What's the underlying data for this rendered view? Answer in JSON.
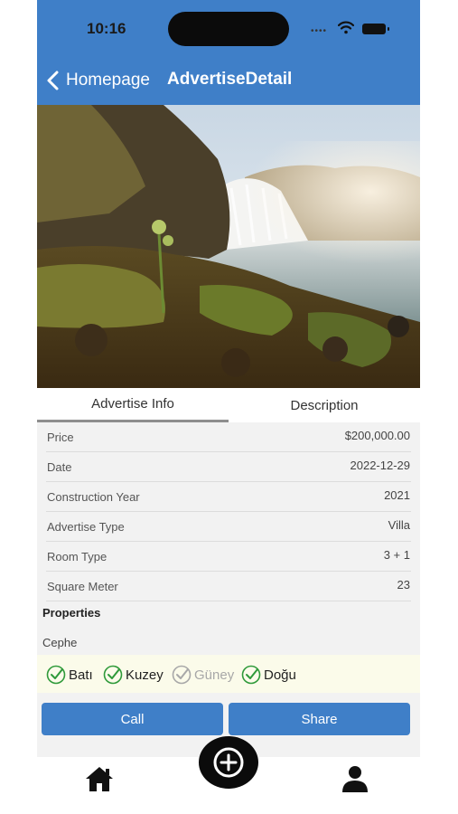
{
  "status_bar": {
    "time": "10:16",
    "dots": "••••"
  },
  "nav": {
    "back_label": "Homepage",
    "title": "AdvertiseDetail"
  },
  "hero": {
    "image": "waterfall-landscape-photo"
  },
  "tabs": [
    {
      "label": "Advertise Info",
      "active": true
    },
    {
      "label": "Description",
      "active": false
    }
  ],
  "details": [
    {
      "label": "Price",
      "value": "$200,000.00"
    },
    {
      "label": "Date",
      "value": "2022-12-29"
    },
    {
      "label": "Construction Year",
      "value": "2021"
    },
    {
      "label": "Advertise Type",
      "value": "Villa"
    },
    {
      "label": "Room Type",
      "value": "3 + 1"
    },
    {
      "label": "Square Meter",
      "value": "23"
    }
  ],
  "properties": {
    "title": "Properties",
    "group": "Cephe",
    "directions": [
      {
        "label": "Batı",
        "checked": true
      },
      {
        "label": "Kuzey",
        "checked": true
      },
      {
        "label": "Güney",
        "checked": false
      },
      {
        "label": "Doğu",
        "checked": true
      }
    ]
  },
  "actions": {
    "call_label": "Call",
    "share_label": "Share"
  },
  "bottom_nav": {
    "icons": [
      "home-icon",
      "add-circle-icon",
      "user-icon"
    ]
  },
  "colors": {
    "primary": "#3f7fc8",
    "check_green": "#2f9a3a",
    "disabled": "#a8a8a8",
    "properties_bg": "#fbfbea",
    "content_bg": "#f2f2f2"
  }
}
